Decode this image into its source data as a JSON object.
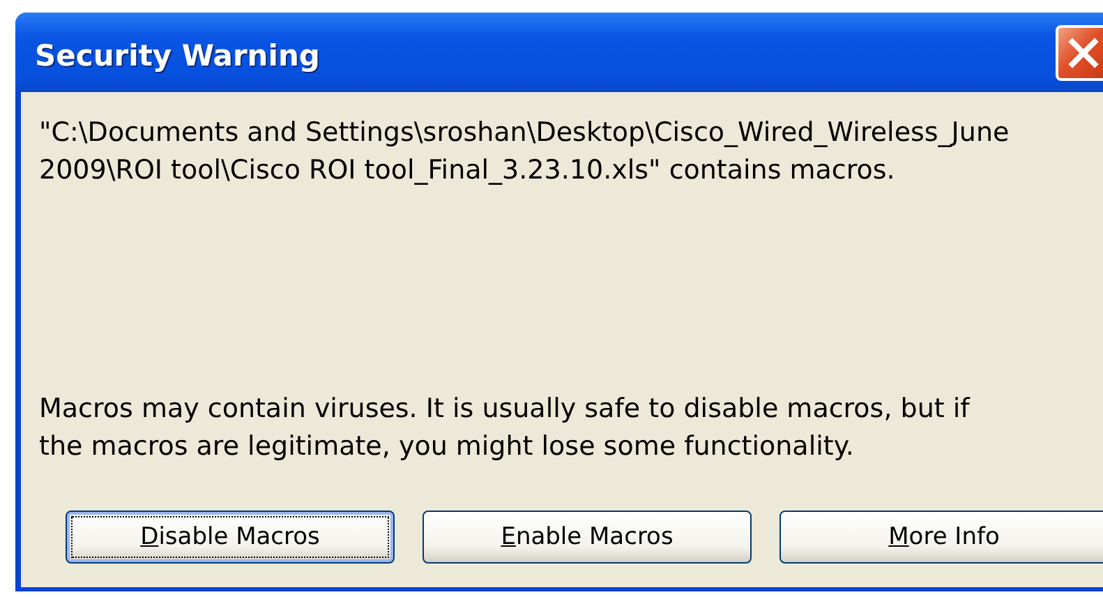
{
  "window": {
    "title": "Security Warning"
  },
  "message": "\"C:\\Documents and Settings\\sroshan\\Desktop\\Cisco_Wired_Wireless_June 2009\\ROI tool\\Cisco ROI tool_Final_3.23.10.xls\" contains macros.",
  "warning": "Macros may contain viruses. It is usually safe to disable macros, but if the macros are legitimate, you might lose some functionality.",
  "buttons": [
    {
      "label": "Disable Macros",
      "focused": true,
      "mnemonic_underlined": true
    },
    {
      "label": "Enable Macros",
      "focused": false,
      "mnemonic_underlined": true
    },
    {
      "label": "More Info",
      "focused": false,
      "mnemonic_underlined": true
    }
  ]
}
